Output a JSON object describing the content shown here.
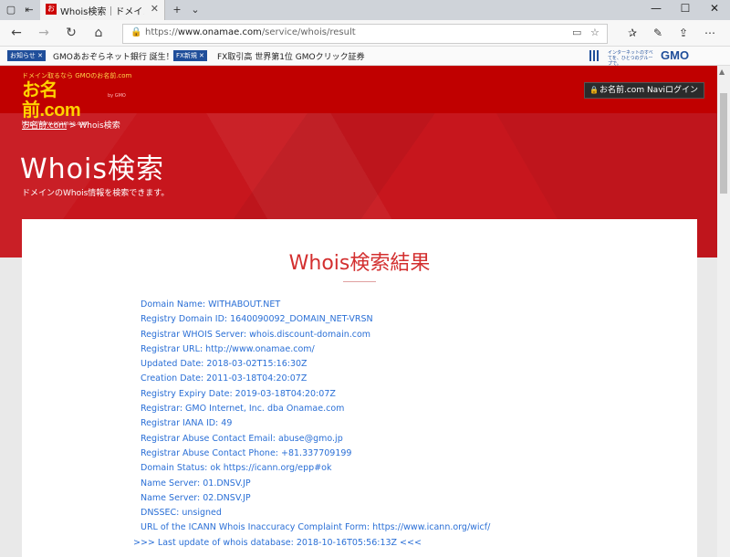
{
  "browser": {
    "tab_title": "Whois検索｜ドメイン取得",
    "url_prefix": "https://",
    "url_host": "www.onamae.com",
    "url_path": "/service/whois/result"
  },
  "favorites": [
    {
      "badge": "お知らせ ✕",
      "text": "GMOあおぞらネット銀行 誕生！"
    },
    {
      "badge": "FX新規 ✕",
      "text": "FX取引高 世界第1位 GMOクリック証券"
    }
  ],
  "gmo": {
    "small": "インターネットのすべてを、ひとつのグループで。",
    "logo": "GMO"
  },
  "header": {
    "logo_tagline": "ドメイン取るなら GMOのお名前.com",
    "logo_main": "お名前.com",
    "logo_url": "http://www.onamae.com",
    "logo_side": "by GMO",
    "navi_login": "お名前.com Naviログイン"
  },
  "breadcrumb": {
    "home": "お名前.com",
    "sep": ">",
    "current": "Whois検索"
  },
  "hero": {
    "title": "Whois検索",
    "subtitle": "ドメインのWhois情報を検索できます。"
  },
  "result": {
    "title": "Whois検索結果",
    "lines": [
      "Domain Name: WITHABOUT.NET",
      "Registry Domain ID: 1640090092_DOMAIN_NET-VRSN",
      "Registrar WHOIS Server: whois.discount-domain.com",
      "Registrar URL: http://www.onamae.com/",
      "Updated Date: 2018-03-02T15:16:30Z",
      "Creation Date: 2011-03-18T04:20:07Z",
      "Registry Expiry Date: 2019-03-18T04:20:07Z",
      "Registrar: GMO Internet, Inc. dba Onamae.com",
      "Registrar IANA ID: 49",
      "Registrar Abuse Contact Email: abuse@gmo.jp",
      "Registrar Abuse Contact Phone: +81.337709199",
      "Domain Status: ok https://icann.org/epp#ok",
      "Name Server: 01.DNSV.JP",
      "Name Server: 02.DNSV.JP",
      "DNSSEC: unsigned",
      "URL of the ICANN Whois Inaccuracy Complaint Form: https://www.icann.org/wicf/",
      ">>> Last update of whois database: 2018-10-16T05:56:13Z <<<"
    ]
  }
}
